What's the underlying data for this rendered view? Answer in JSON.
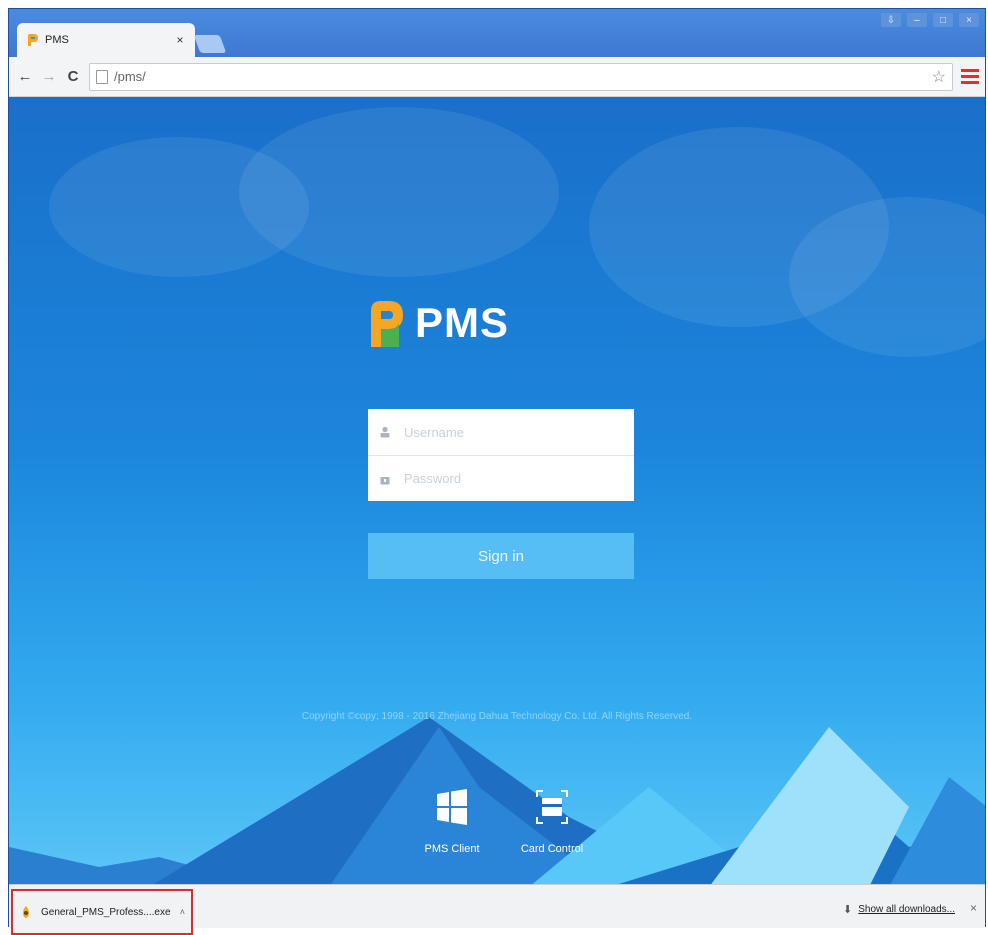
{
  "browser": {
    "tab": {
      "title": "PMS",
      "close": "×"
    },
    "window_buttons": [
      "⇩",
      "–",
      "□",
      "×"
    ],
    "url": "/pms/",
    "nav": {
      "back": "←",
      "forward": "→",
      "reload": "C"
    },
    "star": "☆"
  },
  "page": {
    "logo_text": "PMS",
    "username_placeholder": "Username",
    "password_placeholder": "Password",
    "signin_label": "Sign in",
    "copyright": "Copyright ©copy; 1998 - 2016 Zhejiang Dahua Technology Co. Ltd. All Rights Reserved.",
    "links": [
      {
        "label": "PMS Client",
        "icon": "windows-icon"
      },
      {
        "label": "Card Control",
        "icon": "card-control-icon"
      }
    ]
  },
  "downloads": {
    "file_name": "General_PMS_Profess....exe",
    "caret": "˄",
    "show_all": "Show all downloads...",
    "arrow": "⬇",
    "close": "×"
  },
  "colors": {
    "accent": "#1c86dc",
    "signin": "#56bdf5",
    "highlight_border": "#d32f2f",
    "menu": "#e0322a"
  }
}
